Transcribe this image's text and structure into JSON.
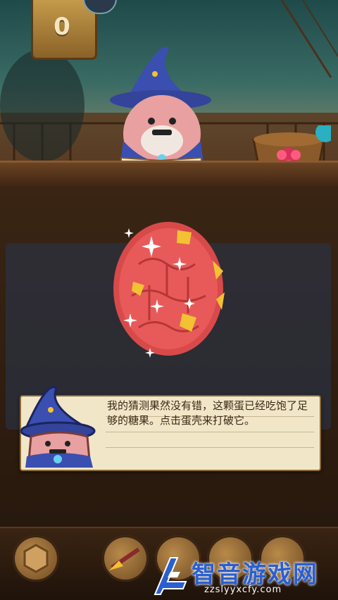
{
  "hud": {
    "score": "0"
  },
  "dialog": {
    "text": "我的猜测果然没有错，这颗蛋已经吃饱了足够的糖果。点击蛋壳来打破它。"
  },
  "watermark": {
    "title": "智音游戏网",
    "url": "zzslyyxcfy.com"
  },
  "colors": {
    "egg": "#d84a4a",
    "egg_spots": "#f2c232",
    "dialog_bg": "#f2e6c8",
    "wizard_hat": "#3a4fb0",
    "watermark": "#2a5fd0"
  },
  "icons": [
    "wizard-character",
    "spell-book",
    "candy-basket",
    "egg-icon",
    "sparkle-icon",
    "check-icon",
    "hexagon-booster-icon",
    "broom-booster-icon",
    "watermark-logo-icon"
  ]
}
